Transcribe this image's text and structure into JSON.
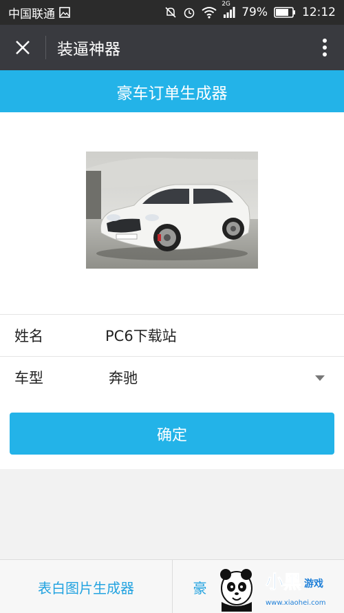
{
  "status_bar": {
    "carrier": "中国联通",
    "network": "2G",
    "battery": "79%",
    "time": "12:12",
    "icons": [
      "image-icon",
      "mute-icon",
      "alarm-icon",
      "wifi-icon",
      "signal-icon",
      "battery-icon"
    ]
  },
  "nav": {
    "title": "装逼神器",
    "close_icon": "close-icon",
    "more_icon": "more-vertical-icon"
  },
  "banner": {
    "title": "豪车订单生成器"
  },
  "form": {
    "name_label": "姓名",
    "name_value": "PC6下载站",
    "car_label": "车型",
    "car_value": "奔驰"
  },
  "confirm_button": "确定",
  "bottom_nav": {
    "tab1": "表白图片生成器",
    "tab2": "豪"
  },
  "watermark": {
    "text": "小黑游戏",
    "url": "www.xiaohei.com"
  },
  "colors": {
    "accent": "#23b3e8",
    "nav_bar": "#393a3f",
    "status_bar": "#2b2b2b",
    "bottom_link": "#23a3e0"
  }
}
